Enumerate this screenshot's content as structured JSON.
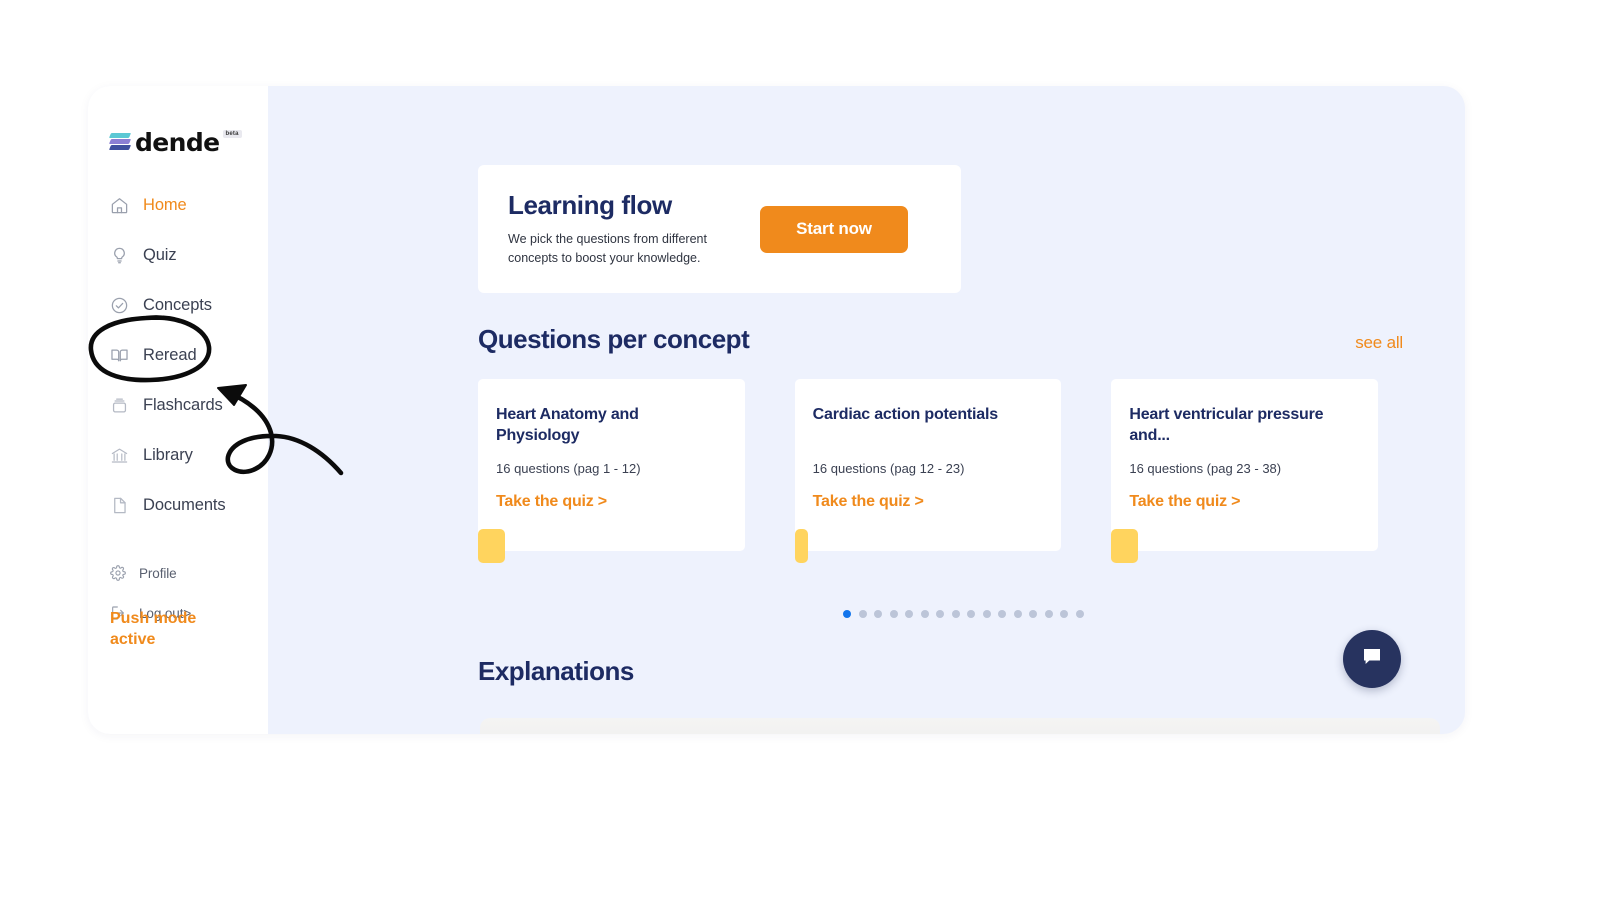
{
  "app": {
    "logo_text": "dende",
    "logo_badge": "beta"
  },
  "sidebar": {
    "items": [
      {
        "label": "Home",
        "icon": "home-icon",
        "active": true
      },
      {
        "label": "Quiz",
        "icon": "lightbulb-icon",
        "active": false
      },
      {
        "label": "Concepts",
        "icon": "check-circle-icon",
        "active": false
      },
      {
        "label": "Reread",
        "icon": "book-open-icon",
        "active": false
      },
      {
        "label": "Flashcards",
        "icon": "cards-icon",
        "active": false
      },
      {
        "label": "Library",
        "icon": "bank-icon",
        "active": false
      },
      {
        "label": "Documents",
        "icon": "document-icon",
        "active": false
      }
    ],
    "footer_items": [
      {
        "label": "Profile",
        "icon": "gear-icon"
      },
      {
        "label": "Log out>",
        "icon": "logout-icon"
      }
    ],
    "push_mode": "Push mode active"
  },
  "learning_flow": {
    "title": "Learning flow",
    "subtitle": "We pick the questions from different concepts to boost your knowledge.",
    "button_label": "Start now"
  },
  "questions_per_concept": {
    "title": "Questions per concept",
    "see_all_label": "see all",
    "cards": [
      {
        "title": "Heart Anatomy and Physiology",
        "meta": "16 questions (pag 1 - 12)",
        "link_label": "Take the quiz >"
      },
      {
        "title": "Cardiac action potentials",
        "meta": "16 questions (pag 12 - 23)",
        "link_label": "Take the quiz >"
      },
      {
        "title": "Heart ventricular pressure and...",
        "meta": "16 questions (pag 23 - 38)",
        "link_label": "Take the quiz >"
      }
    ],
    "pagination": {
      "total": 16,
      "active_index": 0
    }
  },
  "explanations": {
    "title": "Explanations"
  },
  "chat": {
    "icon": "chat-bubble-icon"
  },
  "annotations": {
    "ellipse_target": "Reread",
    "arrow_label": "arrow-pointing-to-reread"
  },
  "colors": {
    "accent_orange": "#f08a1c",
    "navy": "#1d2b63",
    "page_bg": "#eef2fd",
    "yellow_tab": "#ffd45e",
    "dot_active": "#1275ec",
    "chat_fab": "#27335f"
  }
}
